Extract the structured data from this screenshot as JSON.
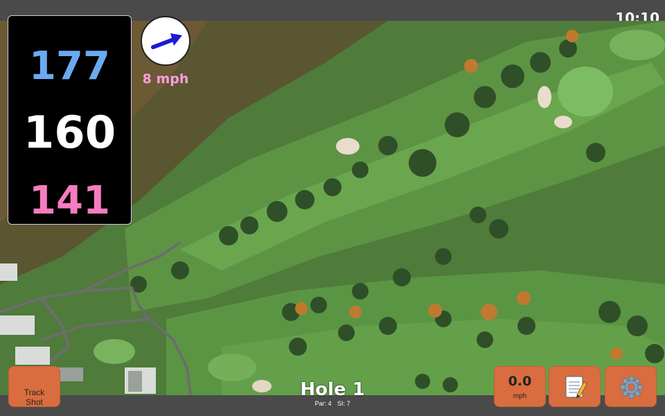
{
  "status": {
    "time": "10:10"
  },
  "distances": {
    "back": "177",
    "middle": "160",
    "front": "141"
  },
  "wind": {
    "speed_label": "8 mph",
    "direction_icon": "arrow-icon"
  },
  "hole": {
    "title": "Hole 1",
    "par": "Par: 4",
    "si": "SI: 7"
  },
  "buttons": {
    "track_shot": "Track\nShot",
    "wind_value": "0.0",
    "wind_unit": "mph",
    "notes_icon": "notepad-icon",
    "settings_icon": "gear-icon"
  },
  "colors": {
    "back_distance": "#6aaaf0",
    "middle_distance": "#ffffff",
    "front_distance": "#f57cc0",
    "button": "#d96d3f",
    "wind_label": "#ff9de0"
  }
}
